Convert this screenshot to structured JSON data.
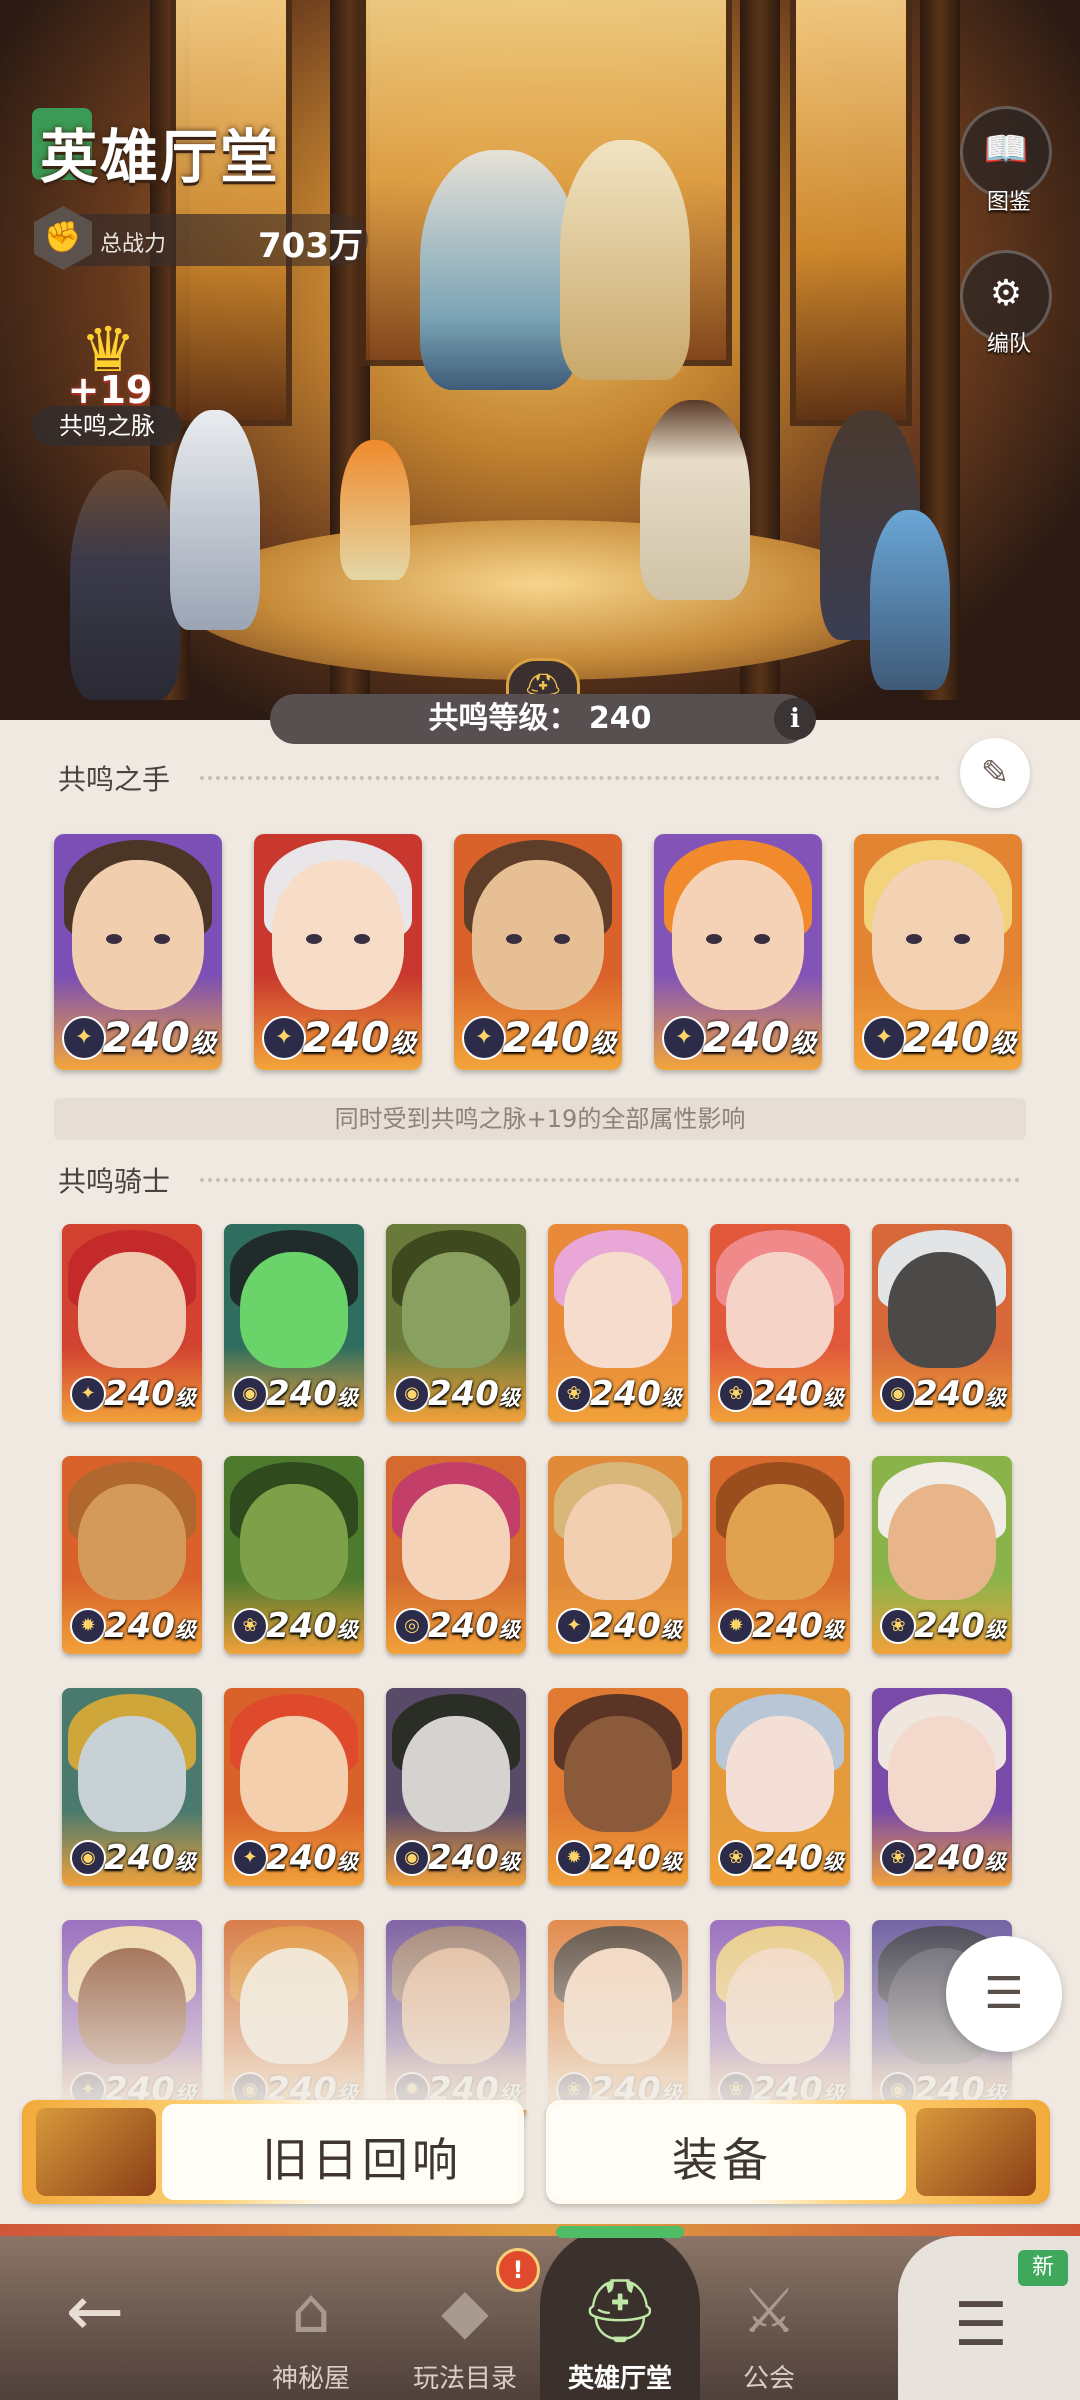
{
  "header": {
    "title": "英雄厅堂",
    "power_label": "总战力",
    "power_value": "703万",
    "vein_plus": "+19",
    "vein_label": "共鸣之脉",
    "side_buttons": [
      {
        "icon": "book-icon",
        "label": "图鉴"
      },
      {
        "icon": "team-gear-icon",
        "label": "编队"
      }
    ]
  },
  "resonance": {
    "level_text": "共鸣等级：  240",
    "info": "i"
  },
  "hands": {
    "title": "共鸣之手",
    "cards": [
      {
        "level": "240",
        "suffix": "级",
        "bg": "#7b4fb5",
        "hair": "#4a3526",
        "skin": "#f1cfae",
        "trim": "#f3a53a"
      },
      {
        "level": "240",
        "suffix": "级",
        "bg": "#c8382e",
        "hair": "#e9e6ea",
        "skin": "#f7dcc7",
        "trim": "#f3a53a"
      },
      {
        "level": "240",
        "suffix": "级",
        "bg": "#d9622b",
        "hair": "#5e3d29",
        "skin": "#e7bf95",
        "trim": "#f3a53a"
      },
      {
        "level": "240",
        "suffix": "级",
        "bg": "#8254b8",
        "hair": "#f08a2c",
        "skin": "#f5d2b5",
        "trim": "#f3a53a"
      },
      {
        "level": "240",
        "suffix": "级",
        "bg": "#e38432",
        "hair": "#f2d27a",
        "skin": "#f2d2b3",
        "trim": "#f3a53a"
      }
    ],
    "note": "同时受到共鸣之脉+19的全部属性影响"
  },
  "knights": {
    "title": "共鸣骑士",
    "level_text": "240",
    "suffix": "级",
    "cards": [
      {
        "bg": "#d14230",
        "hair": "#c42a2a",
        "skin": "#f1c9b0"
      },
      {
        "bg": "#2f6e5e",
        "hair": "#1f2c2a",
        "skin": "#6ad46a"
      },
      {
        "bg": "#6a7a3a",
        "hair": "#3e4a1e",
        "skin": "#8aa060"
      },
      {
        "bg": "#e88a3a",
        "hair": "#e9a7d8",
        "skin": "#f6dccd"
      },
      {
        "bg": "#e2583a",
        "hair": "#f08a8a",
        "skin": "#f6d3c7"
      },
      {
        "bg": "#d6683a",
        "hair": "#e2e4e6",
        "skin": "#4b4a48"
      },
      {
        "bg": "#d9622b",
        "hair": "#b0682e",
        "skin": "#d49a5a"
      },
      {
        "bg": "#4e7a2e",
        "hair": "#2f4b1e",
        "skin": "#7da048"
      },
      {
        "bg": "#d46a30",
        "hair": "#c43e6a",
        "skin": "#f4d3b8"
      },
      {
        "bg": "#e08a3a",
        "hair": "#d9b77a",
        "skin": "#f1cfb0"
      },
      {
        "bg": "#d86a2e",
        "hair": "#9a4e1e",
        "skin": "#e0a24e"
      },
      {
        "bg": "#8ab44a",
        "hair": "#f1ede6",
        "skin": "#e8b48a"
      },
      {
        "bg": "#4a7a6e",
        "hair": "#cfa63a",
        "skin": "#c7d1d6"
      },
      {
        "bg": "#d9622b",
        "hair": "#e04a2c",
        "skin": "#f3cfae"
      },
      {
        "bg": "#5a4a6a",
        "hair": "#2a2e26",
        "skin": "#d6d2d0"
      },
      {
        "bg": "#e07a32",
        "hair": "#5a3424",
        "skin": "#8a5a3a"
      },
      {
        "bg": "#e49a3a",
        "hair": "#b9c6d6",
        "skin": "#f3dfd6"
      },
      {
        "bg": "#7a4aa8",
        "hair": "#efe6e0",
        "skin": "#f3d8cc"
      },
      {
        "bg": "#8a5ab8",
        "hair": "#f0d9a8",
        "skin": "#8a4a2a"
      },
      {
        "bg": "#d46a2e",
        "hair": "#e08a2a",
        "skin": "#f3e6d0"
      },
      {
        "bg": "#6a4a98",
        "hair": "#9a7a6a",
        "skin": "#e1b594"
      },
      {
        "bg": "#e07a32",
        "hair": "#4a3a2e",
        "skin": "#f4d4b8"
      },
      {
        "bg": "#8a5ab8",
        "hair": "#e8c87a",
        "skin": "#f3d6bd"
      },
      {
        "bg": "#5a4a98",
        "hair": "#2a2a3a",
        "skin": "#4a4a5a"
      }
    ]
  },
  "buttons": {
    "echo": "旧日回响",
    "equip": "装备"
  },
  "nav": {
    "items": [
      {
        "label": "",
        "icon": "back-arrow-icon"
      },
      {
        "label": "神秘屋",
        "icon": "mystic-house-icon"
      },
      {
        "label": "玩法目录",
        "icon": "gameplay-catalog-icon"
      },
      {
        "label": "英雄厅堂",
        "icon": "hero-helmet-icon"
      },
      {
        "label": "公会",
        "icon": "guild-swords-icon"
      }
    ],
    "alert": "!",
    "new_badge": "新"
  }
}
